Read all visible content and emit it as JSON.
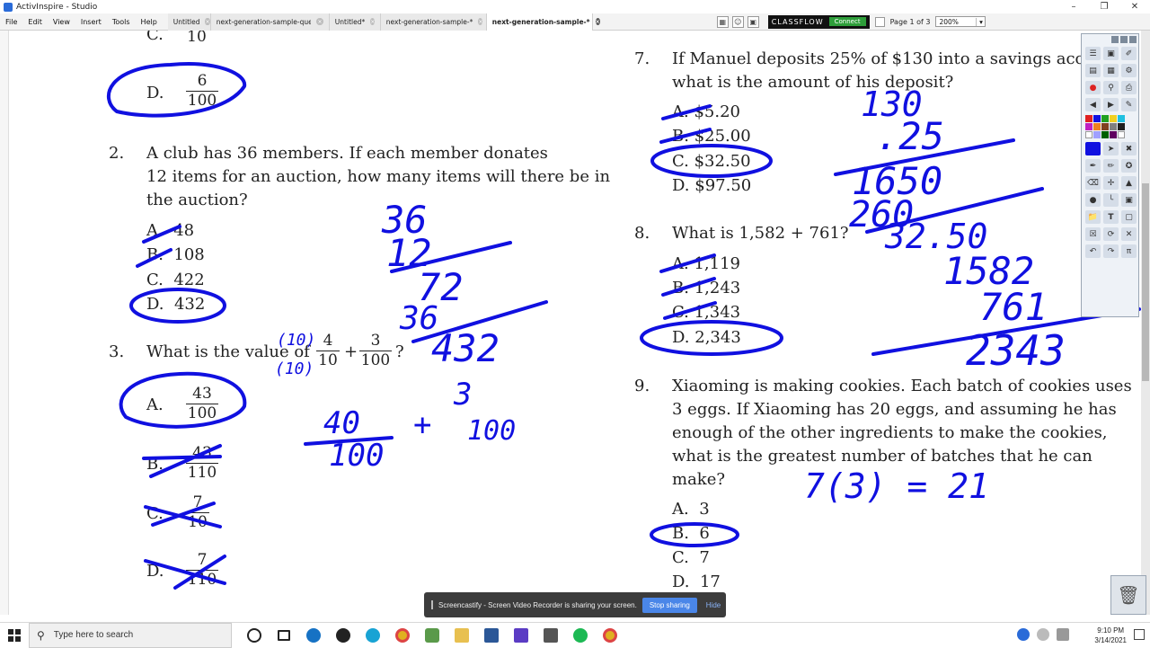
{
  "window": {
    "title": "ActivInspire - Studio"
  },
  "menu": [
    "File",
    "Edit",
    "View",
    "Insert",
    "Tools",
    "Help"
  ],
  "tabs": [
    {
      "label": "Untitled",
      "active": false
    },
    {
      "label": "next-generation-sample-questions-…",
      "active": false
    },
    {
      "label": "Untitled*",
      "active": false
    },
    {
      "label": "next-generation-sample-*",
      "active": false
    },
    {
      "label": "next-generation-sample-*",
      "active": true
    }
  ],
  "classflow": {
    "brand": "CLASSFLOW",
    "connect": "Connect"
  },
  "page_indicator": "Page 1 of 3",
  "zoom": "200%",
  "questions": {
    "q1": {
      "partial_c": "C.",
      "partial_c_den": "10",
      "d_label": "D.",
      "d_num": "6",
      "d_den": "100"
    },
    "q2": {
      "number": "2.",
      "line1": "A club has 36 members. If each member donates",
      "line2": "12 items for an auction, how many items will there be in",
      "line3": "the auction?",
      "choices": [
        {
          "label": "A.",
          "value": "48"
        },
        {
          "label": "B.",
          "value": "108"
        },
        {
          "label": "C.",
          "value": "422"
        },
        {
          "label": "D.",
          "value": "432"
        }
      ]
    },
    "q3": {
      "number": "3.",
      "stem": "What is the value of",
      "f1_num": "4",
      "f1_den": "10",
      "plus": "+",
      "f2_num": "3",
      "f2_den": "100",
      "qmark": "?",
      "choices": [
        {
          "label": "A.",
          "num": "43",
          "den": "100"
        },
        {
          "label": "B.",
          "num": "43",
          "den": "110"
        },
        {
          "label": "C.",
          "num": "7",
          "den": "10"
        },
        {
          "label": "D.",
          "num": "7",
          "den": "110"
        }
      ]
    },
    "q7": {
      "number": "7.",
      "line1": "If Manuel deposits 25% of $130 into a savings acco",
      "line2": "what is the amount of his deposit?",
      "choices": [
        {
          "label": "A.",
          "value": "$5.20"
        },
        {
          "label": "B.",
          "value": "$25.00"
        },
        {
          "label": "C.",
          "value": "$32.50"
        },
        {
          "label": "D.",
          "value": "$97.50"
        }
      ]
    },
    "q8": {
      "number": "8.",
      "stem": "What is 1,582 + 761?",
      "choices": [
        {
          "label": "A.",
          "value": "1,119"
        },
        {
          "label": "B.",
          "value": "1,243"
        },
        {
          "label": "C.",
          "value": "1,343"
        },
        {
          "label": "D.",
          "value": "2,343"
        }
      ]
    },
    "q9": {
      "number": "9.",
      "line1": "Xiaoming is making cookies. Each batch of cookies uses",
      "line2": "3 eggs. If Xiaoming has 20 eggs, and assuming he has",
      "line3": "enough of the other ingredients to make the cookies,",
      "line4": "what is the greatest number of batches that he can",
      "line5": "make?",
      "choices": [
        {
          "label": "A.",
          "value": "3"
        },
        {
          "label": "B.",
          "value": "6"
        },
        {
          "label": "C.",
          "value": "7"
        },
        {
          "label": "D.",
          "value": "17"
        }
      ]
    }
  },
  "handwriting": {
    "q2_work": [
      "36",
      "12",
      "72",
      "36",
      "432"
    ],
    "q3_work": [
      "(10)",
      "(10)",
      "40",
      "100",
      "+",
      "3",
      "100"
    ],
    "q7_work": [
      "130",
      ".25",
      "1650",
      "260",
      "32.50"
    ],
    "q8_work": [
      "1582",
      "761",
      "2343"
    ],
    "q9_work": "7(3) = 21",
    "ink_color": "#1010e0"
  },
  "sharebar": {
    "message": "Screencastify - Screen Video Recorder is sharing your screen.",
    "stop": "Stop sharing",
    "hide": "Hide"
  },
  "taskbar": {
    "search_placeholder": "Type here to search",
    "time": "9:10 PM",
    "date": "3/14/2021"
  }
}
